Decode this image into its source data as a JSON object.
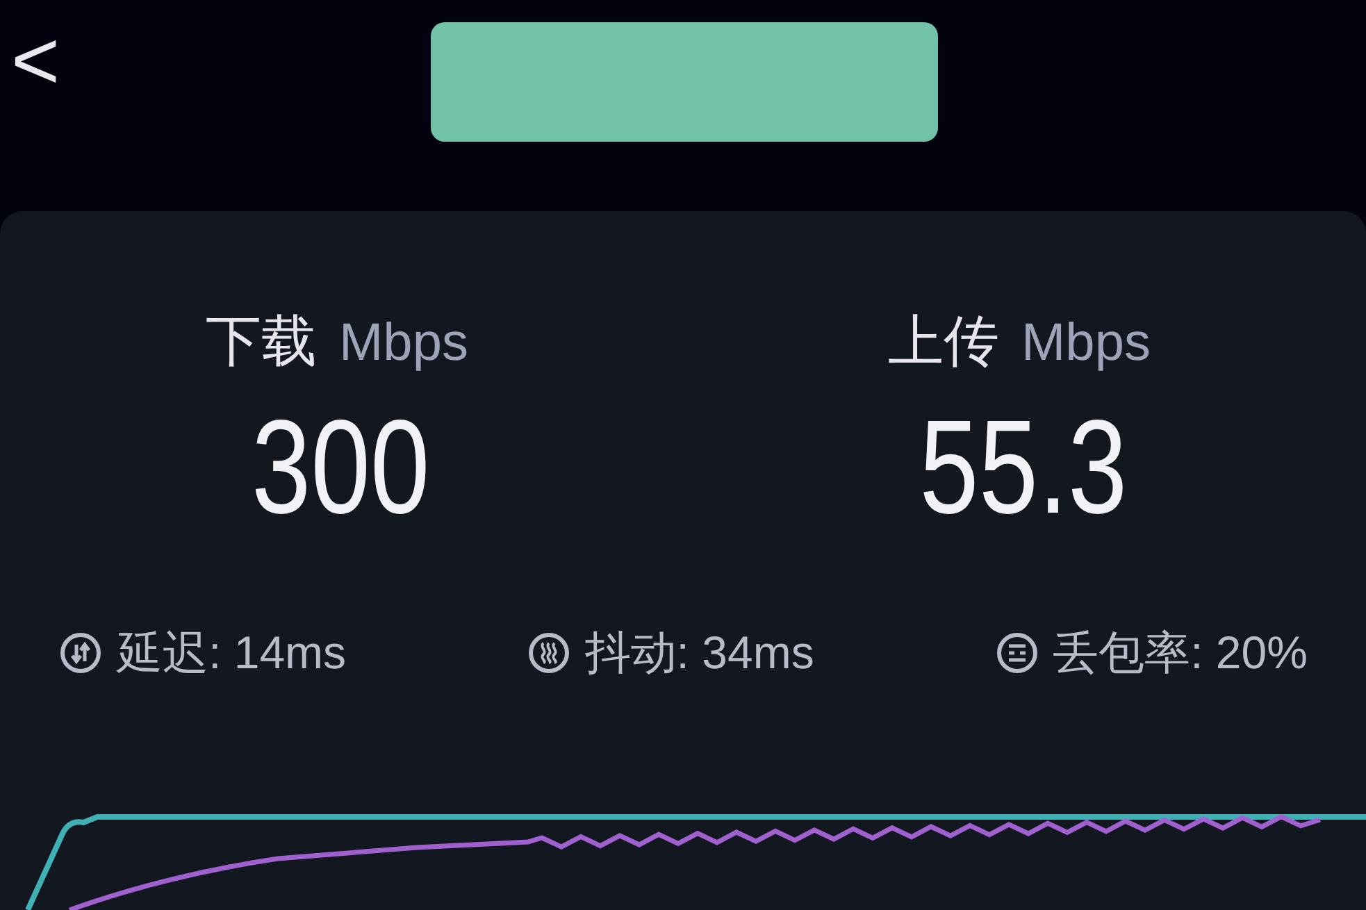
{
  "header": {
    "back": "<"
  },
  "speeds": [
    {
      "label": "下载",
      "unit": "Mbps",
      "value": "300"
    },
    {
      "label": "上传",
      "unit": "Mbps",
      "value": "55.3"
    }
  ],
  "stats": [
    {
      "kind": "latency",
      "text": "延迟: 14ms"
    },
    {
      "kind": "jitter",
      "text": "抖动: 34ms"
    },
    {
      "kind": "loss",
      "text": "丢包率: 20%"
    }
  ]
}
